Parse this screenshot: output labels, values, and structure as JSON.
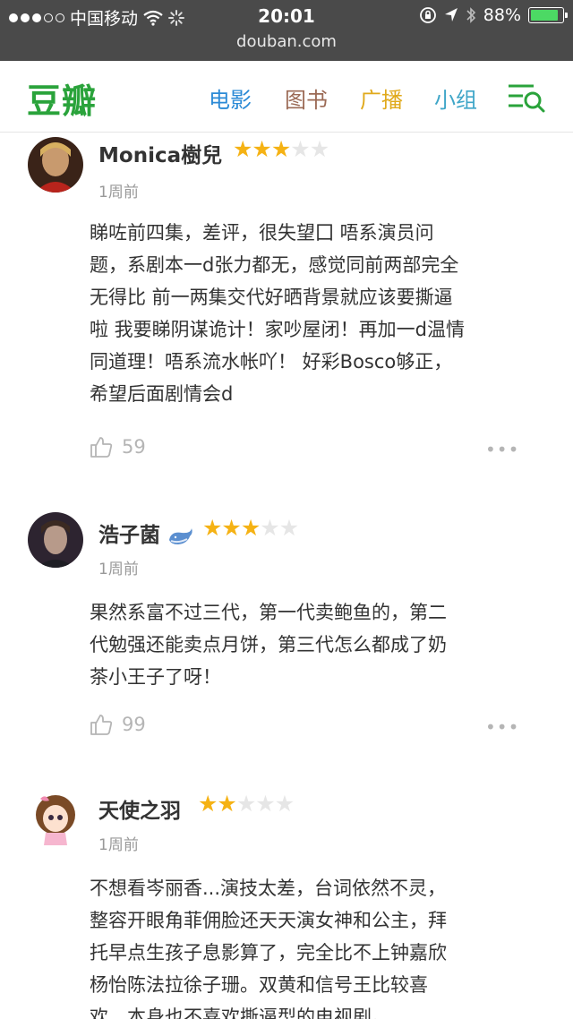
{
  "status_bar": {
    "carrier": "中国移动",
    "time": "20:01",
    "battery": "88%",
    "battery_level": 0.88
  },
  "browser": {
    "url": "douban.com"
  },
  "nav": {
    "logo": "豆瓣",
    "links": [
      "电影",
      "图书",
      "广播",
      "小组"
    ],
    "colors": {
      "logo": "#2aa33b",
      "movie": "#2b8ad6",
      "book": "#9b6a55",
      "broadcast": "#e0a91b",
      "group": "#3fa6c8"
    }
  },
  "comments": [
    {
      "user": "Monica樹兒",
      "rating": 3,
      "time": "1周前",
      "lines": [
        "睇咗前四集，差评，很失望囗 唔系演员问",
        "题，系剧本一d张力都无，感觉同前两部完全",
        "无得比 前一两集交代好晒背景就应该要撕逼",
        "啦 我要睇阴谋诡计！家吵屋闭！再加一d温情",
        "同道理！唔系流水帐吖！ 好彩Bosco够正，",
        "希望后面剧情会d"
      ],
      "likes": "59",
      "more": "•••"
    },
    {
      "user": "浩子菌",
      "rating": 3,
      "time": "1周前",
      "lines": [
        "果然系富不过三代，第一代卖鲍鱼的，第二",
        "代勉强还能卖点月饼，第三代怎么都成了奶",
        "茶小王子了呀！"
      ],
      "likes": "99",
      "more": "•••"
    },
    {
      "user": "天使之羽",
      "rating": 2,
      "time": "1周前",
      "lines": [
        "不想看岑丽香...演技太差，台词依然不灵，",
        "整容开眼角菲佣脸还天天演女神和公主，拜",
        "托早点生孩子息影算了，完全比不上钟嘉欣",
        "杨怡陈法拉徐子珊。双黄和信号王比较喜",
        "欢，本身也不喜欢撕逼型的电视剧。"
      ],
      "likes": "",
      "more": ""
    }
  ]
}
